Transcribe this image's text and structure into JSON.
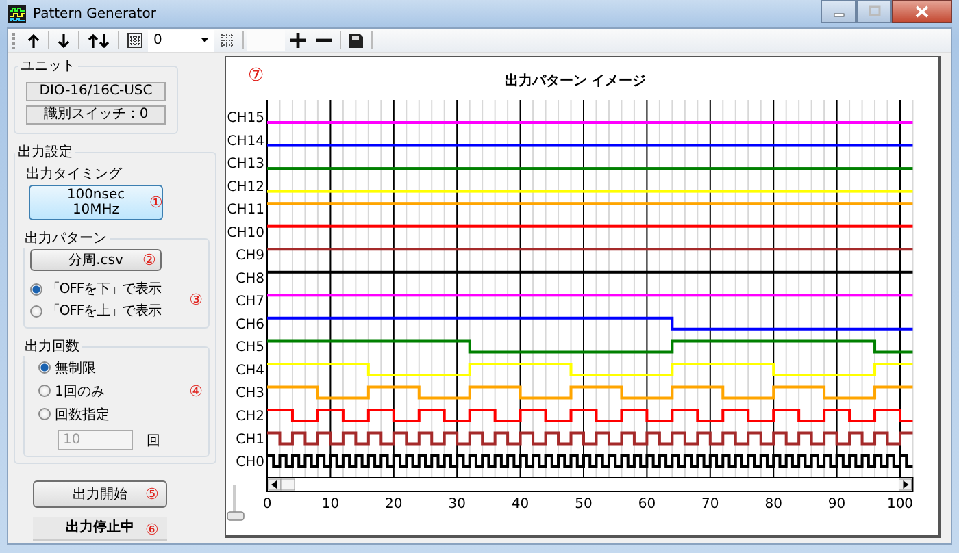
{
  "window": {
    "title": "Pattern Generator"
  },
  "toolbar": {
    "count_dropdown": {
      "value": "0"
    }
  },
  "unit": {
    "title": "ユニット",
    "model": "DIO-16/16C-USC",
    "switch": "識別スイッチ：0"
  },
  "output_settings": {
    "title": "出力設定",
    "timing": {
      "label": "出力タイミング",
      "button": [
        "100nsec",
        "10MHz"
      ],
      "marker": "①"
    },
    "pattern": {
      "title": "出力パターン",
      "button": "分周.csv",
      "marker": "②",
      "options": [
        {
          "label": "「OFFを下」で表示",
          "selected": true
        },
        {
          "label": "「OFFを上」で表示",
          "selected": false
        }
      ],
      "options_marker": "③"
    },
    "repeat": {
      "title": "出力回数",
      "options": [
        {
          "label": "無制限",
          "selected": true
        },
        {
          "label": "1回のみ",
          "selected": false
        },
        {
          "label": "回数指定",
          "selected": false
        }
      ],
      "count": {
        "value": "10",
        "disabled": true
      },
      "unit": "回",
      "marker": "④"
    }
  },
  "start_button": {
    "label": "出力開始",
    "marker": "⑤"
  },
  "status": {
    "text": "出力停止中",
    "marker": "⑥"
  },
  "chart_panel": {
    "marker": "⑦",
    "zoom_slider": {
      "level": 0
    },
    "timing_chart": {
      "title": "出力パターン イメージ",
      "channels": [
        {
          "name": "CH15",
          "color": "#ff00ff"
        },
        {
          "name": "CH14",
          "color": "#0000ff"
        },
        {
          "name": "CH13",
          "color": "#008000"
        },
        {
          "name": "CH12",
          "color": "#ffff00"
        },
        {
          "name": "CH11",
          "color": "#ffa500"
        },
        {
          "name": "CH10",
          "color": "#ff0000"
        },
        {
          "name": "CH9",
          "color": "#a52a2a"
        },
        {
          "name": "CH8",
          "color": "#000000"
        },
        {
          "name": "CH7",
          "color": "#ff00ff"
        },
        {
          "name": "CH6",
          "color": "#0000ff"
        },
        {
          "name": "CH5",
          "color": "#008000"
        },
        {
          "name": "CH4",
          "color": "#ffff00"
        },
        {
          "name": "CH3",
          "color": "#ffa500"
        },
        {
          "name": "CH2",
          "color": "#ff0000"
        },
        {
          "name": "CH1",
          "color": "#a52a2a"
        },
        {
          "name": "CH0",
          "color": "#000000"
        }
      ],
      "axis_labels": [
        "0",
        "10",
        "20",
        "30",
        "40",
        "50",
        "60",
        "70",
        "80",
        "90",
        "100"
      ]
    }
  }
}
